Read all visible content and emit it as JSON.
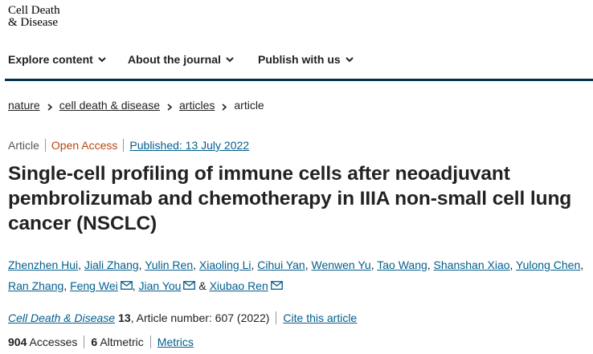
{
  "logo": {
    "line1": "Cell Death",
    "line2": "& Disease"
  },
  "nav": {
    "explore": "Explore content",
    "about": "About the journal",
    "publish": "Publish with us"
  },
  "breadcrumb": {
    "items": [
      "nature",
      "cell death & disease",
      "articles"
    ],
    "current": "article"
  },
  "meta": {
    "type": "Article",
    "access": "Open Access",
    "published": "Published: 13 July 2022",
    "colors": {
      "open_access": "#b74616",
      "link": "#025e8d"
    }
  },
  "title": "Single-cell profiling of immune cells after neoadjuvant pembrolizumab and chemotherapy in IIIA non-small cell lung cancer (NSCLC)",
  "authors": [
    "Zhenzhen Hui",
    "Jiali Zhang",
    "Yulin Ren",
    "Xiaoling Li",
    "Cihui Yan",
    "Wenwen Yu",
    "Tao Wang",
    "Shanshan Xiao",
    "Yulong Chen",
    "Ran Zhang",
    "Feng Wei",
    "Jian You",
    "Xiubao Ren"
  ],
  "author_separators": {
    "comma": ", ",
    "and": " & "
  },
  "citation": {
    "journal": "Cell Death & Disease",
    "volume": "13",
    "article_number": ", Article number: 607 (2022)",
    "cite_link": "Cite this article"
  },
  "metrics": {
    "accesses_value": "904",
    "accesses_label": "Accesses",
    "altmetric_value": "6",
    "altmetric_label": "Altmetric",
    "metrics_link": "Metrics"
  }
}
